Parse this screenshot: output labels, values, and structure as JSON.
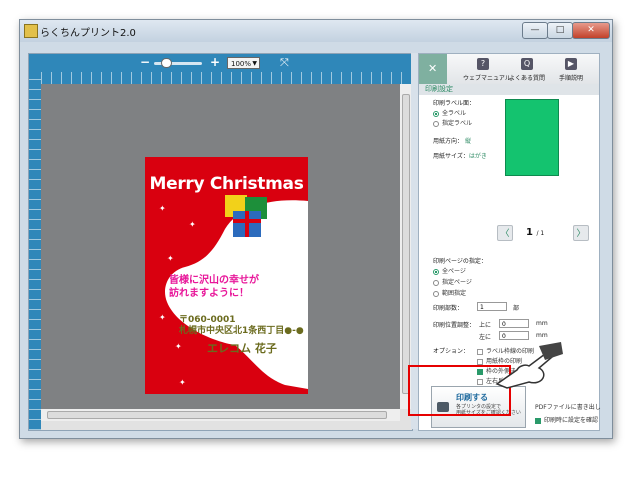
{
  "window": {
    "title": "らくちんプリント2.0",
    "min_label": "—",
    "max_label": "□",
    "close_label": "✕"
  },
  "toolbar": {
    "zoom_minus": "−",
    "zoom_plus": "+",
    "zoom_value": "100%",
    "fit_icon": "⤧",
    "zoom_level": 0.2
  },
  "card": {
    "title": "Merry Christmas",
    "message_line1": "皆様に沢山の幸せが",
    "message_line2": "訪れますように！",
    "postal": "〒060-0001",
    "address": "札幌市中央区北1条西丁目●-●",
    "name": "エレコム 花子",
    "colors": {
      "background": "#d9000f",
      "bell": "#ffffff",
      "message": "#e8179a",
      "address": "#6b6b1e"
    }
  },
  "panel": {
    "tab_icon": "✕",
    "header_buttons": [
      {
        "icon": "?",
        "label": "ウェブマニュアル"
      },
      {
        "icon": "Q",
        "label": "よくある質問"
      },
      {
        "icon": "▶",
        "label": "手順説明"
      }
    ],
    "section_title": "印刷設定",
    "print_label_heading": "印刷ラベル面：",
    "label_options": [
      "全ラベル",
      "指定ラベル"
    ],
    "orientation_label": "用紙方向：",
    "orientation_value": "縦",
    "paper_size_label": "用紙サイズ：",
    "paper_size_value": "はがき",
    "page_prev": "〈",
    "page_next": "〉",
    "page_current": "1",
    "page_total": "/ 1",
    "page_range_heading": "印刷ページの指定：",
    "page_range_options": [
      "全ページ",
      "指定ページ",
      "範囲指定"
    ],
    "copies_label": "印刷部数：",
    "copies_value": "1",
    "copies_unit": "部",
    "offset_label": "印刷位置調整：",
    "offset_top_label": "上に",
    "offset_top_value": "0",
    "offset_left_label": "左に",
    "offset_left_value": "0",
    "offset_unit": "mm",
    "options_label": "オプション：",
    "options": [
      {
        "label": "ラベル枠線の印刷",
        "checked": false
      },
      {
        "label": "用紙枠の印刷",
        "checked": false
      },
      {
        "label": "枠の外側まで印刷",
        "checked": true
      },
      {
        "label": "左右反転",
        "checked": false
      }
    ],
    "print_button": {
      "title": "印刷する",
      "sub1": "各プリンタの設定で",
      "sub2": "用紙サイズをご確認ください"
    },
    "pdf_label": "PDFファイルに書き出し",
    "confirm_label": "印刷時に設定を確認",
    "accent_color": "#2c8a63",
    "preview_color": "#14c36f"
  }
}
